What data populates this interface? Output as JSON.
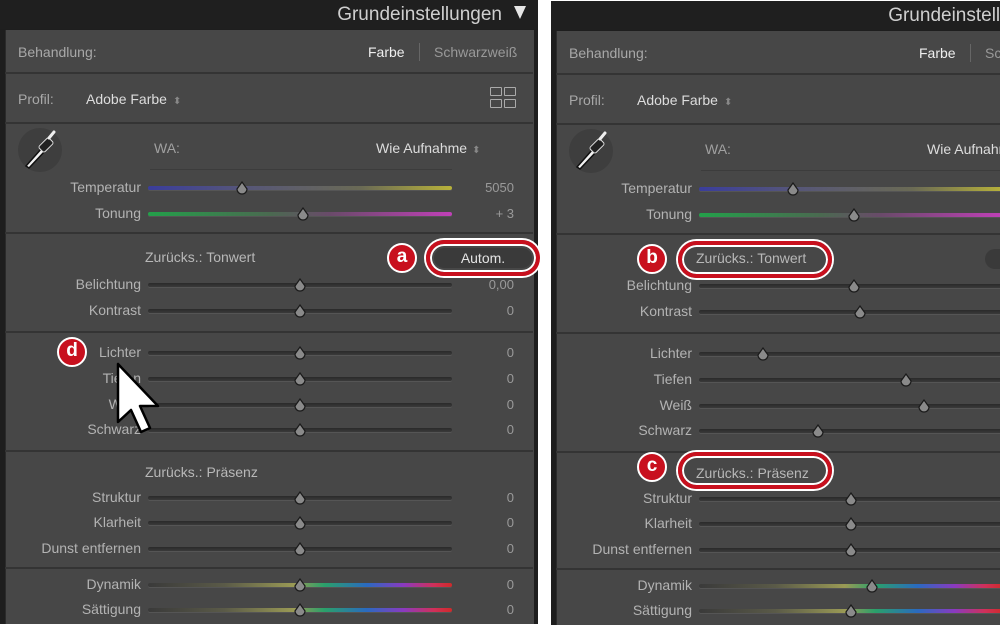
{
  "panels": [
    {
      "title": "Grundeinstellungen",
      "treatment_label": "Behandlung:",
      "treatment_options": [
        "Farbe",
        "Schwarzweiß"
      ],
      "profile_label": "Profil:",
      "profile_value": "Adobe Farbe",
      "wb_label": "WA:",
      "wb_value": "Wie Aufnahme",
      "auto_label": "Autom.",
      "tone_reset": "Zurücks.: Tonwert",
      "presence_reset": "Zurücks.: Präsenz",
      "sliders": [
        {
          "label": "Temperatur",
          "value": "5050",
          "position": 0.31,
          "track": "temp"
        },
        {
          "label": "Tonung",
          "value": "+ 3",
          "position": 0.51,
          "track": "tint"
        },
        {
          "label": "Belichtung",
          "value": "0,00",
          "position": 0.5,
          "track": "gray"
        },
        {
          "label": "Kontrast",
          "value": "0",
          "position": 0.5,
          "track": "gray"
        },
        {
          "label": "Lichter",
          "value": "0",
          "position": 0.5,
          "track": "gray"
        },
        {
          "label": "Tiefen",
          "value": "0",
          "position": 0.5,
          "track": "gray"
        },
        {
          "label": "Weiß",
          "value": "0",
          "position": 0.5,
          "track": "gray"
        },
        {
          "label": "Schwarz",
          "value": "0",
          "position": 0.5,
          "track": "gray"
        },
        {
          "label": "Struktur",
          "value": "0",
          "position": 0.5,
          "track": "gray"
        },
        {
          "label": "Klarheit",
          "value": "0",
          "position": 0.5,
          "track": "gray"
        },
        {
          "label": "Dunst entfernen",
          "value": "0",
          "position": 0.5,
          "track": "gray"
        },
        {
          "label": "Dynamik",
          "value": "0",
          "position": 0.5,
          "track": "sat"
        },
        {
          "label": "Sättigung",
          "value": "0",
          "position": 0.5,
          "track": "sat"
        }
      ]
    },
    {
      "title": "Grundeinstellungen",
      "treatment_label": "Behandlung:",
      "treatment_options": [
        "Farbe",
        "Schwarzweiß"
      ],
      "profile_label": "Profil:",
      "profile_value": "Adobe Farbe",
      "wb_label": "WA:",
      "wb_value": "Wie Aufnahme",
      "tone_reset": "Zurücks.: Tonwert",
      "presence_reset": "Zurücks.: Präsenz",
      "sliders": [
        {
          "label": "Temperatur",
          "position": 0.31,
          "track": "temp"
        },
        {
          "label": "Tonung",
          "position": 0.51,
          "track": "tint"
        },
        {
          "label": "Belichtung",
          "position": 0.51,
          "track": "gray"
        },
        {
          "label": "Kontrast",
          "position": 0.53,
          "track": "gray"
        },
        {
          "label": "Lichter",
          "position": 0.21,
          "track": "gray"
        },
        {
          "label": "Tiefen",
          "position": 0.68,
          "track": "gray"
        },
        {
          "label": "Weiß",
          "position": 0.74,
          "track": "gray"
        },
        {
          "label": "Schwarz",
          "position": 0.39,
          "track": "gray"
        },
        {
          "label": "Struktur",
          "position": 0.5,
          "track": "gray"
        },
        {
          "label": "Klarheit",
          "position": 0.5,
          "track": "gray"
        },
        {
          "label": "Dunst entfernen",
          "position": 0.5,
          "track": "gray"
        },
        {
          "label": "Dynamik",
          "position": 0.57,
          "track": "sat"
        },
        {
          "label": "Sättigung",
          "position": 0.5,
          "track": "sat"
        }
      ]
    }
  ],
  "annotations": {
    "a": "a",
    "b": "b",
    "c": "c",
    "d": "d"
  },
  "colors": {
    "annotation": "#c8101e",
    "panel": "#474747",
    "header": "#1f1f1f"
  }
}
